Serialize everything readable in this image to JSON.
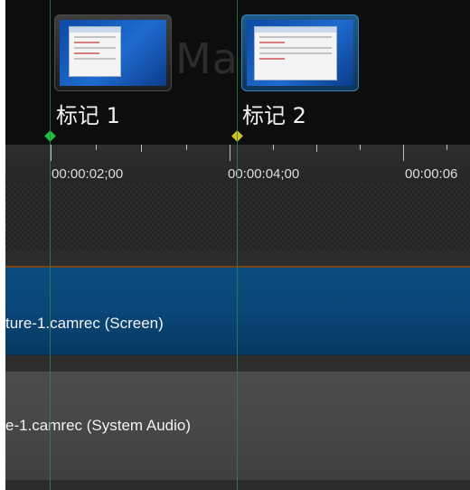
{
  "timeline": {
    "background_title": "Ma",
    "markers": [
      {
        "label": "标记 1",
        "color": "#1fbf3f",
        "selected": false
      },
      {
        "label": "标记 2",
        "color": "#d4c21f",
        "selected": true
      }
    ],
    "ruler": {
      "labels": [
        "00:00:02;00",
        "00:00:04;00",
        "00:00:06"
      ]
    },
    "tracks": {
      "screen_clip": {
        "label": "ture-1.camrec (Screen)",
        "color": "#0a4677"
      },
      "audio_clip": {
        "label": "e-1.camrec (System Audio)",
        "color": "#464646"
      }
    },
    "accent_colors": {
      "playhead": "#1d8a4e",
      "track_separator": "#7a4416",
      "selected_marker_frame": "#1e5a88"
    }
  }
}
